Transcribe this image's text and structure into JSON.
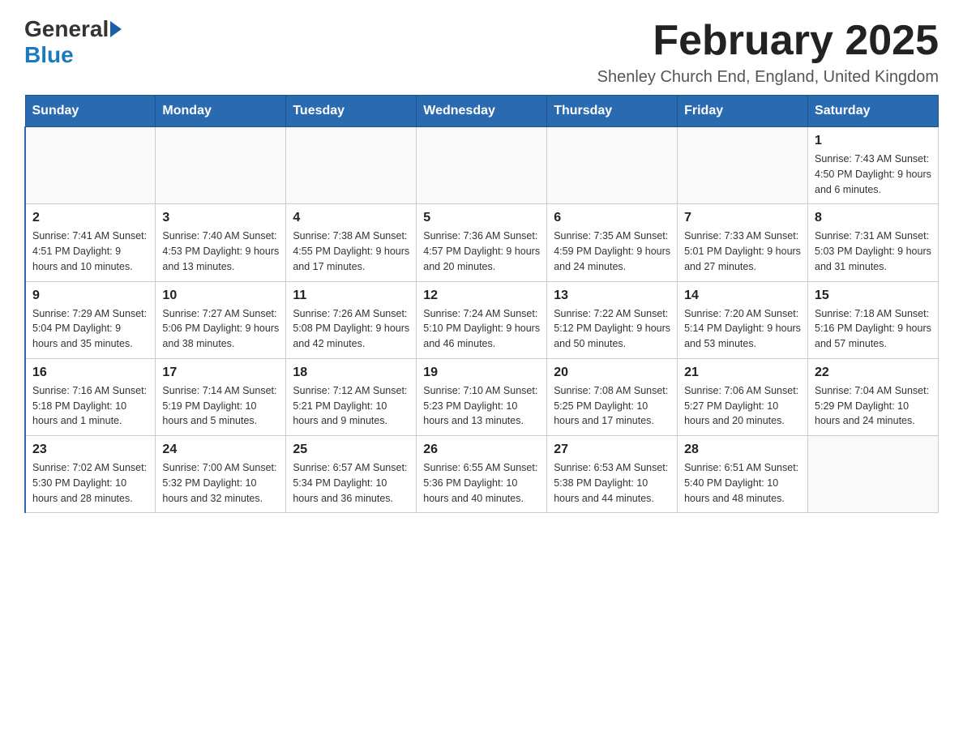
{
  "logo": {
    "general": "General",
    "blue": "Blue"
  },
  "header": {
    "title": "February 2025",
    "location": "Shenley Church End, England, United Kingdom"
  },
  "weekdays": [
    "Sunday",
    "Monday",
    "Tuesday",
    "Wednesday",
    "Thursday",
    "Friday",
    "Saturday"
  ],
  "weeks": [
    [
      {
        "day": "",
        "info": ""
      },
      {
        "day": "",
        "info": ""
      },
      {
        "day": "",
        "info": ""
      },
      {
        "day": "",
        "info": ""
      },
      {
        "day": "",
        "info": ""
      },
      {
        "day": "",
        "info": ""
      },
      {
        "day": "1",
        "info": "Sunrise: 7:43 AM\nSunset: 4:50 PM\nDaylight: 9 hours and 6 minutes."
      }
    ],
    [
      {
        "day": "2",
        "info": "Sunrise: 7:41 AM\nSunset: 4:51 PM\nDaylight: 9 hours and 10 minutes."
      },
      {
        "day": "3",
        "info": "Sunrise: 7:40 AM\nSunset: 4:53 PM\nDaylight: 9 hours and 13 minutes."
      },
      {
        "day": "4",
        "info": "Sunrise: 7:38 AM\nSunset: 4:55 PM\nDaylight: 9 hours and 17 minutes."
      },
      {
        "day": "5",
        "info": "Sunrise: 7:36 AM\nSunset: 4:57 PM\nDaylight: 9 hours and 20 minutes."
      },
      {
        "day": "6",
        "info": "Sunrise: 7:35 AM\nSunset: 4:59 PM\nDaylight: 9 hours and 24 minutes."
      },
      {
        "day": "7",
        "info": "Sunrise: 7:33 AM\nSunset: 5:01 PM\nDaylight: 9 hours and 27 minutes."
      },
      {
        "day": "8",
        "info": "Sunrise: 7:31 AM\nSunset: 5:03 PM\nDaylight: 9 hours and 31 minutes."
      }
    ],
    [
      {
        "day": "9",
        "info": "Sunrise: 7:29 AM\nSunset: 5:04 PM\nDaylight: 9 hours and 35 minutes."
      },
      {
        "day": "10",
        "info": "Sunrise: 7:27 AM\nSunset: 5:06 PM\nDaylight: 9 hours and 38 minutes."
      },
      {
        "day": "11",
        "info": "Sunrise: 7:26 AM\nSunset: 5:08 PM\nDaylight: 9 hours and 42 minutes."
      },
      {
        "day": "12",
        "info": "Sunrise: 7:24 AM\nSunset: 5:10 PM\nDaylight: 9 hours and 46 minutes."
      },
      {
        "day": "13",
        "info": "Sunrise: 7:22 AM\nSunset: 5:12 PM\nDaylight: 9 hours and 50 minutes."
      },
      {
        "day": "14",
        "info": "Sunrise: 7:20 AM\nSunset: 5:14 PM\nDaylight: 9 hours and 53 minutes."
      },
      {
        "day": "15",
        "info": "Sunrise: 7:18 AM\nSunset: 5:16 PM\nDaylight: 9 hours and 57 minutes."
      }
    ],
    [
      {
        "day": "16",
        "info": "Sunrise: 7:16 AM\nSunset: 5:18 PM\nDaylight: 10 hours and 1 minute."
      },
      {
        "day": "17",
        "info": "Sunrise: 7:14 AM\nSunset: 5:19 PM\nDaylight: 10 hours and 5 minutes."
      },
      {
        "day": "18",
        "info": "Sunrise: 7:12 AM\nSunset: 5:21 PM\nDaylight: 10 hours and 9 minutes."
      },
      {
        "day": "19",
        "info": "Sunrise: 7:10 AM\nSunset: 5:23 PM\nDaylight: 10 hours and 13 minutes."
      },
      {
        "day": "20",
        "info": "Sunrise: 7:08 AM\nSunset: 5:25 PM\nDaylight: 10 hours and 17 minutes."
      },
      {
        "day": "21",
        "info": "Sunrise: 7:06 AM\nSunset: 5:27 PM\nDaylight: 10 hours and 20 minutes."
      },
      {
        "day": "22",
        "info": "Sunrise: 7:04 AM\nSunset: 5:29 PM\nDaylight: 10 hours and 24 minutes."
      }
    ],
    [
      {
        "day": "23",
        "info": "Sunrise: 7:02 AM\nSunset: 5:30 PM\nDaylight: 10 hours and 28 minutes."
      },
      {
        "day": "24",
        "info": "Sunrise: 7:00 AM\nSunset: 5:32 PM\nDaylight: 10 hours and 32 minutes."
      },
      {
        "day": "25",
        "info": "Sunrise: 6:57 AM\nSunset: 5:34 PM\nDaylight: 10 hours and 36 minutes."
      },
      {
        "day": "26",
        "info": "Sunrise: 6:55 AM\nSunset: 5:36 PM\nDaylight: 10 hours and 40 minutes."
      },
      {
        "day": "27",
        "info": "Sunrise: 6:53 AM\nSunset: 5:38 PM\nDaylight: 10 hours and 44 minutes."
      },
      {
        "day": "28",
        "info": "Sunrise: 6:51 AM\nSunset: 5:40 PM\nDaylight: 10 hours and 48 minutes."
      },
      {
        "day": "",
        "info": ""
      }
    ]
  ]
}
